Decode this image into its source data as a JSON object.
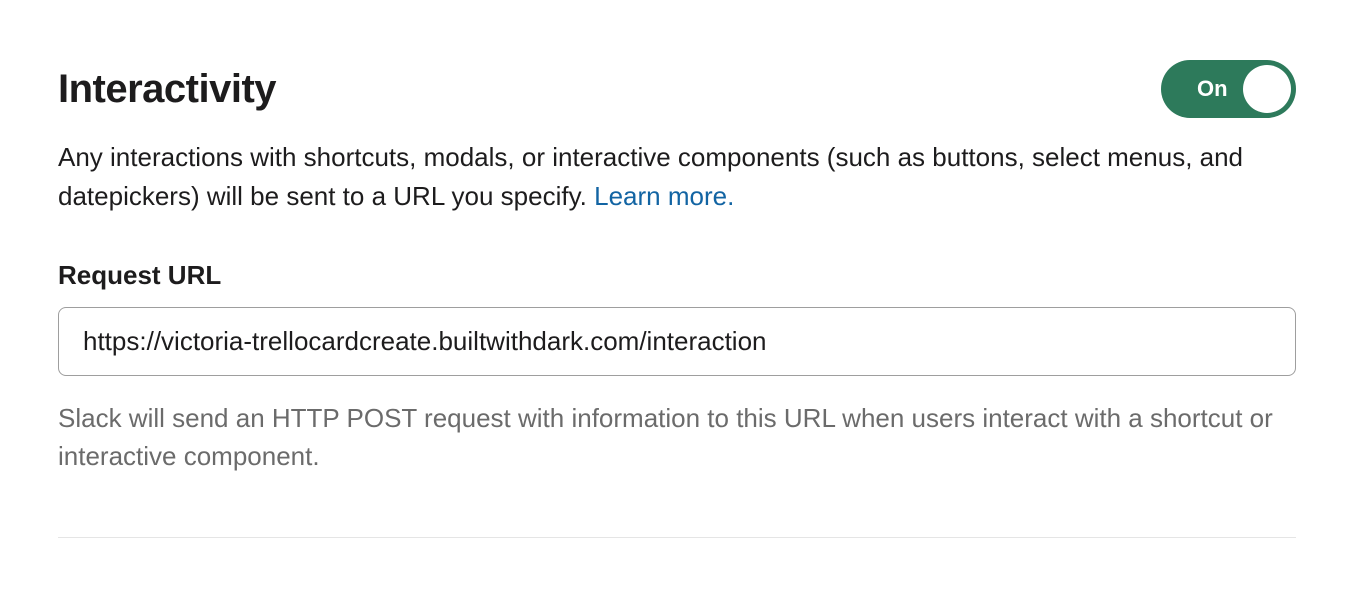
{
  "section": {
    "title": "Interactivity",
    "toggle": {
      "state_label": "On"
    },
    "description_text": "Any interactions with shortcuts, modals, or interactive components (such as buttons, select menus, and datepickers) will be sent to a URL you specify. ",
    "learn_more_label": "Learn more."
  },
  "request_url": {
    "label": "Request URL",
    "value": "https://victoria-trellocardcreate.builtwithdark.com/interaction",
    "help_text": "Slack will send an HTTP POST request with information to this URL when users interact with a shortcut or interactive component."
  }
}
